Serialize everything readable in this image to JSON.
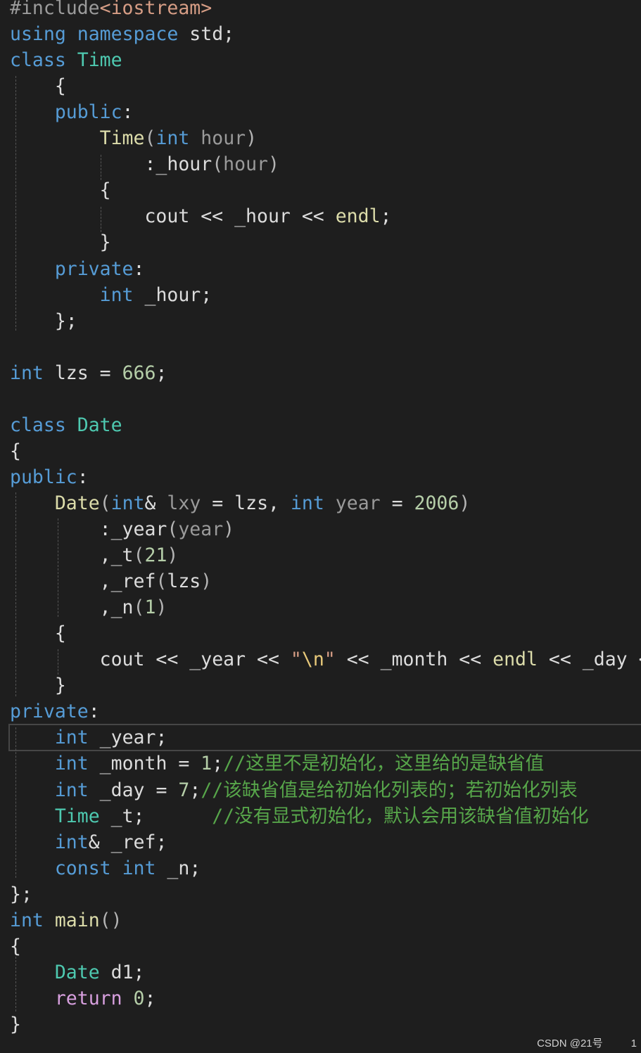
{
  "editor": {
    "lines": [
      [
        [
          "preproc",
          "#include"
        ],
        [
          "header",
          "<iostream>"
        ]
      ],
      [
        [
          "kw",
          "using"
        ],
        [
          "plain",
          " "
        ],
        [
          "kw",
          "namespace"
        ],
        [
          "plain",
          " std;"
        ]
      ],
      [
        [
          "kw",
          "class"
        ],
        [
          "plain",
          " "
        ],
        [
          "type",
          "Time"
        ]
      ],
      [
        [
          "plain",
          "    {"
        ]
      ],
      [
        [
          "access",
          "    public"
        ],
        [
          "plain",
          ":"
        ]
      ],
      [
        [
          "plain",
          "        "
        ],
        [
          "func",
          "Time"
        ],
        [
          "punc",
          "("
        ],
        [
          "kw",
          "int"
        ],
        [
          "plain",
          " "
        ],
        [
          "param",
          "hour"
        ],
        [
          "punc",
          ")"
        ]
      ],
      [
        [
          "plain",
          "            :"
        ],
        [
          "var",
          "_hour"
        ],
        [
          "punc",
          "("
        ],
        [
          "param",
          "hour"
        ],
        [
          "punc",
          ")"
        ]
      ],
      [
        [
          "plain",
          "        {"
        ]
      ],
      [
        [
          "plain",
          "            cout << "
        ],
        [
          "var",
          "_hour"
        ],
        [
          "plain",
          " << "
        ],
        [
          "func",
          "endl"
        ],
        [
          "plain",
          ";"
        ]
      ],
      [
        [
          "plain",
          "        }"
        ]
      ],
      [
        [
          "access",
          "    private"
        ],
        [
          "plain",
          ":"
        ]
      ],
      [
        [
          "plain",
          "        "
        ],
        [
          "kw",
          "int"
        ],
        [
          "plain",
          " "
        ],
        [
          "var",
          "_hour"
        ],
        [
          "plain",
          ";"
        ]
      ],
      [
        [
          "plain",
          "    };"
        ]
      ],
      [
        [
          "plain",
          ""
        ]
      ],
      [
        [
          "kw",
          "int"
        ],
        [
          "plain",
          " lzs = "
        ],
        [
          "num",
          "666"
        ],
        [
          "plain",
          ";"
        ]
      ],
      [
        [
          "plain",
          ""
        ]
      ],
      [
        [
          "kw",
          "class"
        ],
        [
          "plain",
          " "
        ],
        [
          "type",
          "Date"
        ]
      ],
      [
        [
          "plain",
          "{"
        ]
      ],
      [
        [
          "access",
          "public"
        ],
        [
          "plain",
          ":"
        ]
      ],
      [
        [
          "plain",
          "    "
        ],
        [
          "func",
          "Date"
        ],
        [
          "punc",
          "("
        ],
        [
          "kw",
          "int"
        ],
        [
          "plain",
          "& "
        ],
        [
          "param",
          "lxy"
        ],
        [
          "plain",
          " = lzs, "
        ],
        [
          "kw",
          "int"
        ],
        [
          "plain",
          " "
        ],
        [
          "param",
          "year"
        ],
        [
          "plain",
          " = "
        ],
        [
          "num",
          "2006"
        ],
        [
          "punc",
          ")"
        ]
      ],
      [
        [
          "plain",
          "        :"
        ],
        [
          "var",
          "_year"
        ],
        [
          "punc",
          "("
        ],
        [
          "param",
          "year"
        ],
        [
          "punc",
          ")"
        ]
      ],
      [
        [
          "plain",
          "        ,"
        ],
        [
          "var",
          "_t"
        ],
        [
          "punc",
          "("
        ],
        [
          "num",
          "21"
        ],
        [
          "punc",
          ")"
        ]
      ],
      [
        [
          "plain",
          "        ,"
        ],
        [
          "var",
          "_ref"
        ],
        [
          "punc",
          "("
        ],
        [
          "plain",
          "lzs"
        ],
        [
          "punc",
          ")"
        ]
      ],
      [
        [
          "plain",
          "        ,"
        ],
        [
          "var",
          "_n"
        ],
        [
          "punc",
          "("
        ],
        [
          "num",
          "1"
        ],
        [
          "punc",
          ")"
        ]
      ],
      [
        [
          "plain",
          "    {"
        ]
      ],
      [
        [
          "plain",
          "        cout << "
        ],
        [
          "var",
          "_year"
        ],
        [
          "plain",
          " << "
        ],
        [
          "str",
          "\""
        ],
        [
          "esc",
          "\\n"
        ],
        [
          "str",
          "\""
        ],
        [
          "plain",
          " << "
        ],
        [
          "var",
          "_month"
        ],
        [
          "plain",
          " << "
        ],
        [
          "func",
          "endl"
        ],
        [
          "plain",
          " << "
        ],
        [
          "var",
          "_day"
        ],
        [
          "plain",
          " << e"
        ]
      ],
      [
        [
          "plain",
          "    }"
        ]
      ],
      [
        [
          "access",
          "private"
        ],
        [
          "plain",
          ":"
        ]
      ],
      [
        [
          "plain",
          "    "
        ],
        [
          "kw",
          "int"
        ],
        [
          "plain",
          " "
        ],
        [
          "var",
          "_year"
        ],
        [
          "plain",
          ";"
        ]
      ],
      [
        [
          "plain",
          "    "
        ],
        [
          "kw",
          "int"
        ],
        [
          "plain",
          " "
        ],
        [
          "var",
          "_month"
        ],
        [
          "plain",
          " = "
        ],
        [
          "num",
          "1"
        ],
        [
          "plain",
          ";"
        ],
        [
          "comment",
          "//这里不是初始化，这里给的是缺省值"
        ]
      ],
      [
        [
          "plain",
          "    "
        ],
        [
          "kw",
          "int"
        ],
        [
          "plain",
          " "
        ],
        [
          "var",
          "_day"
        ],
        [
          "plain",
          " = "
        ],
        [
          "num",
          "7"
        ],
        [
          "plain",
          ";"
        ],
        [
          "comment",
          "//该缺省值是给初始化列表的；若初始化列表"
        ]
      ],
      [
        [
          "plain",
          "    "
        ],
        [
          "type",
          "Time"
        ],
        [
          "plain",
          " "
        ],
        [
          "var",
          "_t"
        ],
        [
          "plain",
          ";      "
        ],
        [
          "comment",
          "//没有显式初始化，默认会用该缺省值初始化"
        ]
      ],
      [
        [
          "plain",
          "    "
        ],
        [
          "kw",
          "int"
        ],
        [
          "plain",
          "& "
        ],
        [
          "var",
          "_ref"
        ],
        [
          "plain",
          ";"
        ]
      ],
      [
        [
          "plain",
          "    "
        ],
        [
          "kw",
          "const"
        ],
        [
          "plain",
          " "
        ],
        [
          "kw",
          "int"
        ],
        [
          "plain",
          " "
        ],
        [
          "var",
          "_n"
        ],
        [
          "plain",
          ";"
        ]
      ],
      [
        [
          "plain",
          "};"
        ]
      ],
      [
        [
          "kw",
          "int"
        ],
        [
          "plain",
          " "
        ],
        [
          "func",
          "main"
        ],
        [
          "punc",
          "()"
        ]
      ],
      [
        [
          "plain",
          "{"
        ]
      ],
      [
        [
          "plain",
          "    "
        ],
        [
          "type",
          "Date"
        ],
        [
          "plain",
          " "
        ],
        [
          "var",
          "d1"
        ],
        [
          "plain",
          ";"
        ]
      ],
      [
        [
          "plain",
          "    "
        ],
        [
          "ctrl",
          "return"
        ],
        [
          "plain",
          " "
        ],
        [
          "num",
          "0"
        ],
        [
          "plain",
          ";"
        ]
      ],
      [
        [
          "plain",
          "}"
        ]
      ]
    ]
  },
  "watermark": {
    "text": "CSDN @21号",
    "line_number": "1"
  }
}
